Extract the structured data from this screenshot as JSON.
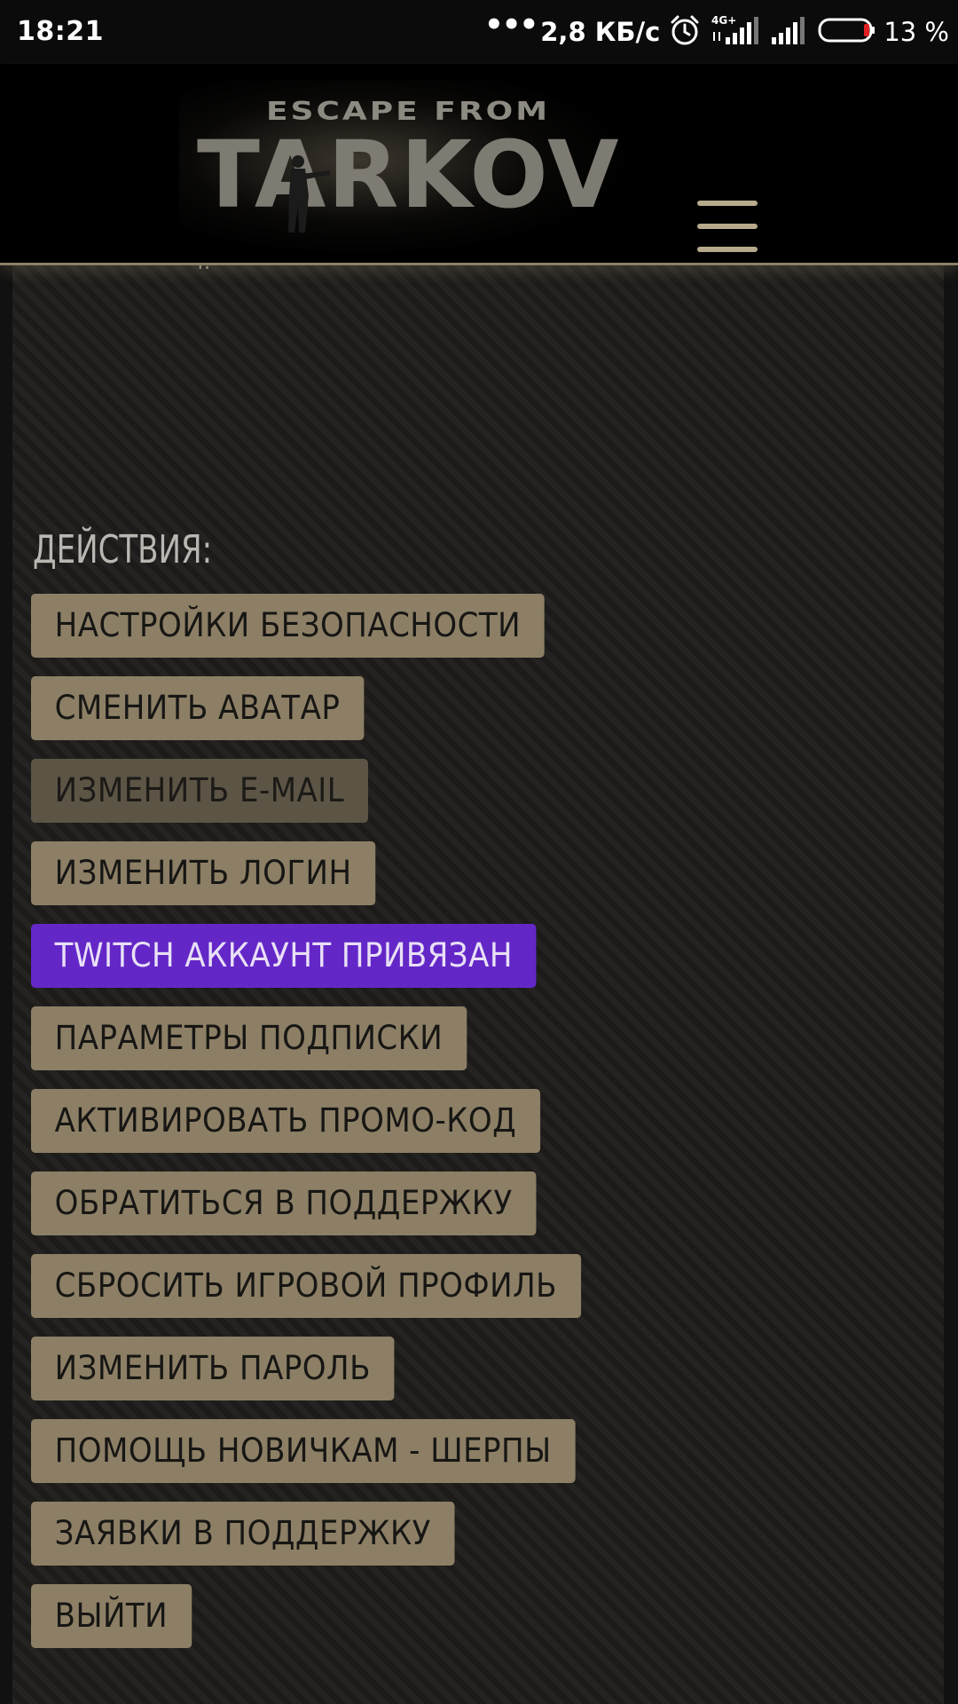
{
  "status_bar": {
    "time": "18:21",
    "dots": "•••",
    "net_speed": "2,8 КБ/с",
    "network_type": "4G+",
    "battery_text": "13 %",
    "icons": [
      "alarm-icon",
      "signal-4g-icon",
      "signal-icon",
      "battery-icon"
    ]
  },
  "header": {
    "logo_line1": "ESCAPE FROM",
    "logo_line2": "TARKOV",
    "menu_icon": "hamburger-menu-icon"
  },
  "colors": {
    "button_bg": "#8c7f65",
    "button_dim_bg": "#5c5445",
    "twitch_bg": "#6427c7",
    "page_bg": "#1e1d1b",
    "header_bg": "#000000"
  },
  "content": {
    "partial_text": "ч.",
    "actions_title": "ДЕЙСТВИЯ:",
    "actions": [
      {
        "label": "НАСТРОЙКИ БЕЗОПАСНОСТИ"
      },
      {
        "label": "СМЕНИТЬ АВАТАР"
      },
      {
        "label": "ИЗМЕНИТЬ E-MAIL"
      },
      {
        "label": "ИЗМЕНИТЬ ЛОГИН"
      },
      {
        "label": "TWITCH АККАУНТ ПРИВЯЗАН"
      },
      {
        "label": "ПАРАМЕТРЫ ПОДПИСКИ"
      },
      {
        "label": "АКТИВИРОВАТЬ ПРОМО-КОД"
      },
      {
        "label": "ОБРАТИТЬСЯ В ПОДДЕРЖКУ"
      },
      {
        "label": "СБРОСИТЬ ИГРОВОЙ ПРОФИЛЬ"
      },
      {
        "label": "ИЗМЕНИТЬ ПАРОЛЬ"
      },
      {
        "label": "ПОМОЩЬ НОВИЧКАМ - ШЕРПЫ"
      },
      {
        "label": "ЗАЯВКИ В ПОДДЕРЖКУ"
      },
      {
        "label": "ВЫЙТИ"
      }
    ]
  }
}
